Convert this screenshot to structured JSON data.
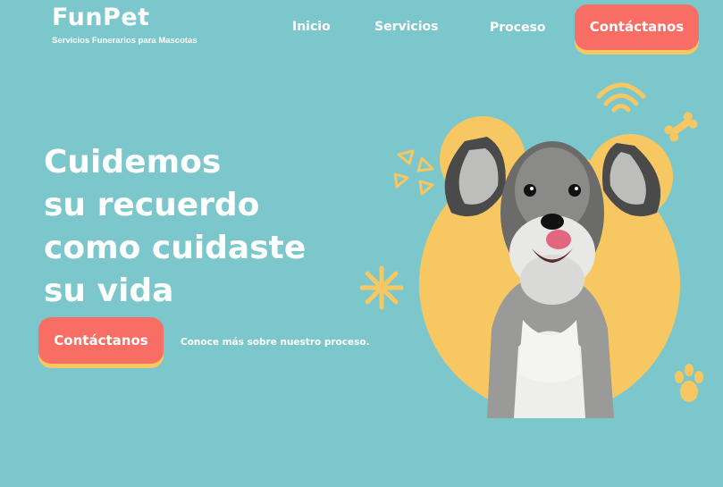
{
  "brand": {
    "name": "FunPet",
    "tagline": "Servicios Funerarios para Mascotas"
  },
  "nav": {
    "items": [
      {
        "label": "Inicio"
      },
      {
        "label": "Servicios"
      },
      {
        "label": "Proceso"
      }
    ],
    "cta_label": "Contáctanos"
  },
  "hero": {
    "headline_lines": [
      "Cuidemos",
      "su recuerdo",
      "como cuidaste",
      "su vida"
    ],
    "cta_label": "Contáctanos",
    "secondary_link": "Conoce más sobre nuestro proceso."
  },
  "colors": {
    "background": "#7cc7cc",
    "accent_red": "#f86d64",
    "accent_yellow": "#f7c762",
    "text": "#ffffff"
  },
  "icons": [
    "wifi-signal-icon",
    "bone-icon",
    "triangles-icon",
    "sparkle-icon",
    "paw-icon"
  ]
}
